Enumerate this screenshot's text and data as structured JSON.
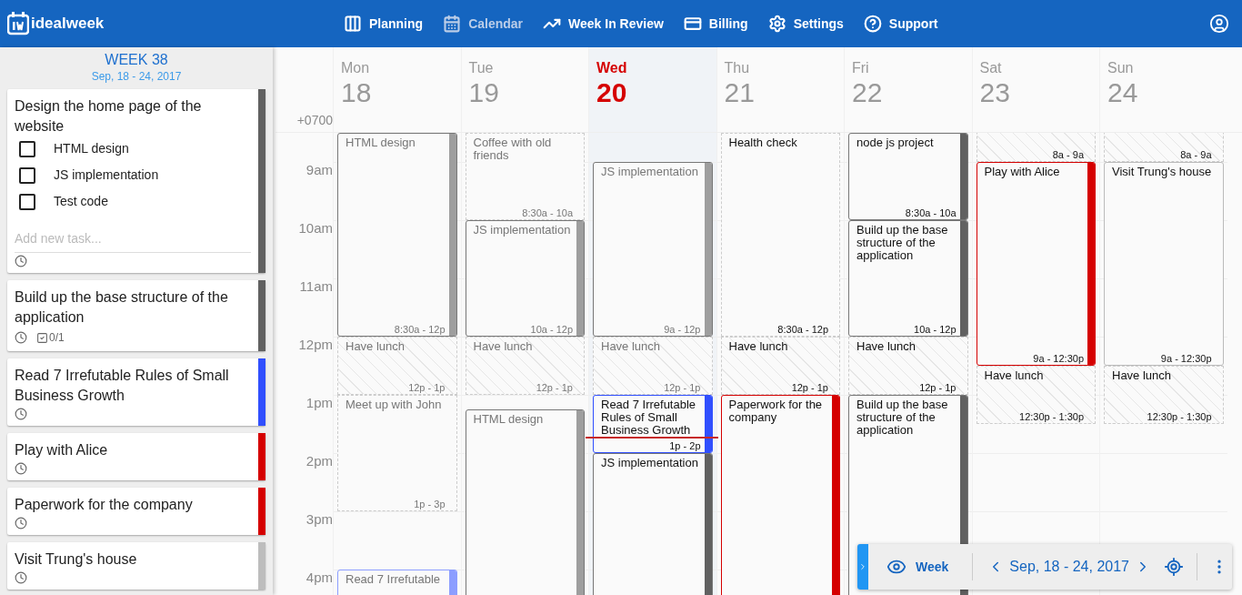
{
  "navbar": {
    "logo": "idealweek",
    "items": [
      {
        "label": "Planning",
        "selected": false
      },
      {
        "label": "Calendar",
        "selected": true
      },
      {
        "label": "Week In Review",
        "selected": false
      },
      {
        "label": "Billing",
        "selected": false
      },
      {
        "label": "Settings",
        "selected": false
      },
      {
        "label": "Support",
        "selected": false
      }
    ]
  },
  "sidebar": {
    "week": "WEEK 38",
    "range": "Sep, 18 - 24, 2017",
    "tasks": [
      {
        "title": "Design the home page of the website",
        "color": "#616161",
        "subtasks": [
          {
            "label": "HTML design",
            "checked": false
          },
          {
            "label": "JS implementation",
            "checked": false
          },
          {
            "label": "Test code",
            "checked": false
          }
        ],
        "placeholder": "Add new task..."
      },
      {
        "title": "Build up the base structure of the application",
        "color": "#616161",
        "progress": "0/1"
      },
      {
        "title": "Read 7 Irrefutable Rules of Small Business Growth",
        "color": "#304ffe"
      },
      {
        "title": "Play with Alice",
        "color": "#d50000"
      },
      {
        "title": "Paperwork for the company",
        "color": "#d50000"
      },
      {
        "title": "Visit Trung's house",
        "color": "#bdbdbd"
      }
    ]
  },
  "calendar": {
    "timezone": "+0700",
    "hours": [
      "9am",
      "10am",
      "11am",
      "12pm",
      "1pm",
      "2pm",
      "3pm",
      "4pm"
    ],
    "days": [
      {
        "name": "Mon",
        "date": "18",
        "selected": false,
        "events": [
          {
            "kind": "task",
            "title": "HTML design",
            "time": "8:30a - 12p",
            "color": "#9e9e9e",
            "outlined": false,
            "past": true
          },
          {
            "kind": "break",
            "title": "Have lunch",
            "time": "12p - 1p",
            "past": true
          },
          {
            "kind": "event",
            "title": "Meet up with John",
            "time": "1p - 3p",
            "past": true
          },
          {
            "kind": "task",
            "title": "Read 7 Irrefutable",
            "color": "#8c9eff",
            "outlined": true,
            "past": true
          }
        ]
      },
      {
        "name": "Tue",
        "date": "19",
        "selected": false,
        "events": [
          {
            "kind": "event",
            "title": "Coffee with old friends",
            "time": "8:30a - 10a",
            "past": true
          },
          {
            "kind": "task",
            "title": "JS implementation",
            "time": "10a - 12p",
            "color": "#9e9e9e",
            "outlined": false,
            "past": true
          },
          {
            "kind": "break",
            "title": "Have lunch",
            "time": "12p - 1p",
            "past": true
          },
          {
            "kind": "task",
            "title": "HTML design",
            "color": "#9e9e9e",
            "outlined": false,
            "past": true
          }
        ]
      },
      {
        "name": "Wed",
        "date": "20",
        "selected": true,
        "events": [
          {
            "kind": "task",
            "title": "JS implementation",
            "time": "9a - 12p",
            "color": "#9e9e9e",
            "outlined": false,
            "past": true
          },
          {
            "kind": "break",
            "title": "Have lunch",
            "time": "12p - 1p",
            "past": true
          },
          {
            "kind": "task",
            "title": "Read 7 Irrefutable Rules of Small Business Growth",
            "time": "1p - 2p",
            "color": "#304ffe",
            "outlined": true,
            "past": false
          },
          {
            "kind": "task",
            "title": "JS implementation",
            "color": "#616161",
            "outlined": false,
            "past": false
          }
        ]
      },
      {
        "name": "Thu",
        "date": "21",
        "selected": false,
        "events": [
          {
            "kind": "event",
            "title": "Health check",
            "time": "8:30a - 12p",
            "past": false
          },
          {
            "kind": "break",
            "title": "Have lunch",
            "time": "12p - 1p",
            "past": false
          },
          {
            "kind": "task",
            "title": "Paperwork for the company",
            "color": "#d50000",
            "outlined": true,
            "past": false
          }
        ]
      },
      {
        "name": "Fri",
        "date": "22",
        "selected": false,
        "events": [
          {
            "kind": "task",
            "title": "node js project",
            "time": "8:30a - 10a",
            "color": "#616161",
            "outlined": false,
            "past": false
          },
          {
            "kind": "task",
            "title": "Build up the base structure of the application",
            "time": "10a - 12p",
            "color": "#616161",
            "outlined": false,
            "past": false
          },
          {
            "kind": "break",
            "title": "Have lunch",
            "time": "12p - 1p",
            "past": false
          },
          {
            "kind": "task",
            "title": "Build up the base structure of the application",
            "color": "#616161",
            "outlined": false,
            "past": false
          }
        ]
      },
      {
        "name": "Sat",
        "date": "23",
        "selected": false,
        "events": [
          {
            "kind": "break",
            "time": "8a - 9a",
            "past": false
          },
          {
            "kind": "task",
            "title": "Play with Alice",
            "time": "9a - 12:30p",
            "color": "#d50000",
            "outlined": true,
            "past": false
          },
          {
            "kind": "break",
            "title": "Have lunch",
            "time": "12:30p - 1:30p",
            "past": false
          }
        ]
      },
      {
        "name": "Sun",
        "date": "24",
        "selected": false,
        "events": [
          {
            "kind": "break",
            "time": "8a - 9a",
            "past": false
          },
          {
            "kind": "plain",
            "title": "Visit Trung's house",
            "time": "9a - 12:30p",
            "past": false
          },
          {
            "kind": "break",
            "title": "Have lunch",
            "time": "12:30p - 1:30p",
            "past": false
          }
        ]
      }
    ]
  },
  "toolbar": {
    "view": "Week",
    "range": "Sep, 18 - 24, 2017"
  }
}
